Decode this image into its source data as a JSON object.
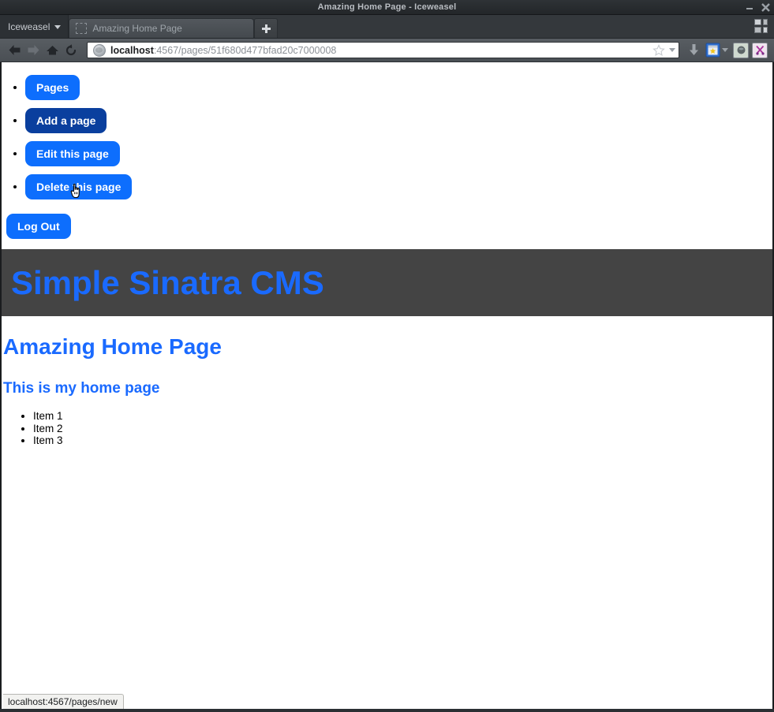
{
  "window": {
    "title": "Amazing Home Page - Iceweasel",
    "minimize_label": "minimize",
    "close_label": "close"
  },
  "tabbar": {
    "app_menu_label": "Iceweasel",
    "tabs": [
      {
        "title": "Amazing Home Page",
        "active": true
      }
    ],
    "new_tab_label": "+",
    "tab_groups_label": "Tab Groups"
  },
  "toolbar": {
    "back_label": "Back",
    "forward_label": "Forward",
    "home_label": "Home",
    "reload_label": "Reload",
    "url_host": "localhost",
    "url_path": ":4567/pages/51f680d477bfad20c7000008",
    "url_full": "localhost:4567/pages/51f680d477bfad20c7000008",
    "bookmark_star_label": "Bookmark this page",
    "downloads_label": "Downloads",
    "bookmarks_label": "Bookmarks",
    "extension_1_label": "Extension",
    "extension_2_label": "Extension"
  },
  "page": {
    "nav_buttons": [
      {
        "label": "Pages",
        "hovered": false
      },
      {
        "label": "Add a page",
        "hovered": true
      },
      {
        "label": "Edit this page",
        "hovered": false
      },
      {
        "label": "Delete this page",
        "hovered": false
      }
    ],
    "logout_label": "Log Out",
    "site_title": "Simple Sinatra CMS",
    "heading": "Amazing Home Page",
    "subheading": "This is my home page",
    "list_items": [
      "Item 1",
      "Item 2",
      "Item 3"
    ]
  },
  "statusbar": {
    "link_target": "localhost:4567/pages/new"
  },
  "colors": {
    "button_blue": "#0d6efd",
    "button_blue_hover": "#0a3f9e",
    "heading_blue": "#1a6aff",
    "header_band": "#444444"
  }
}
